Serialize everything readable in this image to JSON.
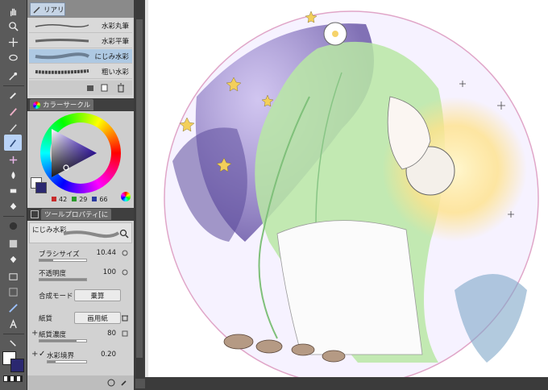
{
  "subtool": {
    "tab_label": "リアリ",
    "brushes": [
      {
        "name": "水彩丸筆",
        "active": false
      },
      {
        "name": "水彩平筆",
        "active": false
      },
      {
        "name": "にじみ水彩",
        "active": true
      },
      {
        "name": "粗い水彩",
        "active": false
      }
    ]
  },
  "color_panel": {
    "title": "カラーサークル",
    "h": "42",
    "s": "29",
    "v": "66",
    "main_color": "#ffffff",
    "sub_color": "#2b2870"
  },
  "tool_property": {
    "title": "ツールプロパティ[に",
    "preset_name": "にじみ水彩",
    "brush_size_label": "ブラシサイズ",
    "brush_size_value": "10.44",
    "opacity_label": "不透明度",
    "opacity_value": "100",
    "blend_label": "合成モード",
    "blend_value": "乗算",
    "paper_label": "紙質",
    "paper_value": "画用紙",
    "paper_density_label": "紙質濃度",
    "paper_density_value": "80",
    "watercolor_edge_label": "水彩境界",
    "watercolor_edge_value": "0.20",
    "watercolor_edge_checked": true
  },
  "colors": {
    "active_blue": "#aec9e3",
    "panel_header": "#3f3f3f"
  }
}
